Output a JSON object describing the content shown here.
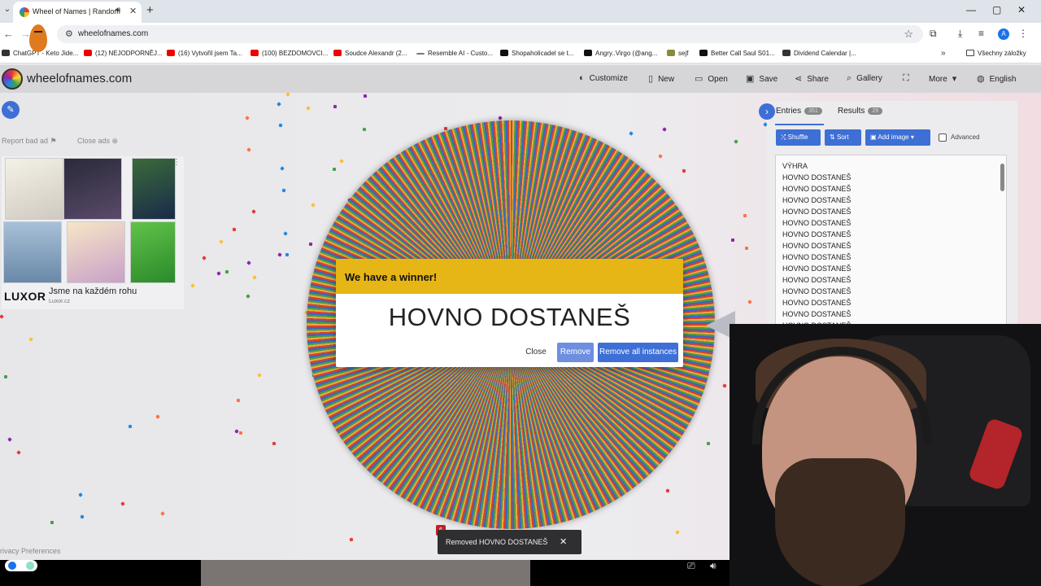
{
  "browser": {
    "tab_title": "Wheel of Names | Random",
    "url": "wheelofnames.com",
    "profile_initial": "A",
    "bookmarks": [
      {
        "label": "ChatGPT - Keto Jide...",
        "icon": "chatgpt-icon"
      },
      {
        "label": "(12) NEJODPORNĚJ...",
        "icon": "youtube-icon"
      },
      {
        "label": "(16) Vytvořil jsem Ta...",
        "icon": "youtube-icon"
      },
      {
        "label": "(100) BEZDOMOVCI...",
        "icon": "youtube-icon"
      },
      {
        "label": "Soudce Alexandr (2...",
        "icon": "youtube-icon"
      },
      {
        "label": "Resemble AI - Custo...",
        "icon": "resemble-icon"
      },
      {
        "label": "Shopaholicadel se t...",
        "icon": "x-icon"
      },
      {
        "label": "Angry..Virgo (@ang...",
        "icon": "tiktok-icon"
      },
      {
        "label": "sejf",
        "icon": "sejf-icon"
      },
      {
        "label": "Better Call Saul S01...",
        "icon": "film-icon"
      },
      {
        "label": "Dividend Calendar |...",
        "icon": "calendar-icon"
      }
    ],
    "bookmarks_folder": "Všechny záložky"
  },
  "site": {
    "logo_text": "wheelofnames.com",
    "menu": [
      {
        "label": "Customize",
        "icon": "palette-icon"
      },
      {
        "label": "New",
        "icon": "file-icon"
      },
      {
        "label": "Open",
        "icon": "folder-open-icon"
      },
      {
        "label": "Save",
        "icon": "save-icon"
      },
      {
        "label": "Share",
        "icon": "share-icon"
      },
      {
        "label": "Gallery",
        "icon": "search-icon"
      },
      {
        "label": "",
        "icon": "fullscreen-icon"
      },
      {
        "label": "More",
        "icon": "chevron-down-icon"
      },
      {
        "label": "English",
        "icon": "globe-icon"
      }
    ]
  },
  "ad": {
    "report_label": "Report bad ad",
    "close_label": "Close ads",
    "brand": "LUXOR",
    "title": "Jsme na každém rohu",
    "url": "Luxor.cz"
  },
  "privacy_label": "rivacy Preferences",
  "panel": {
    "tabs": [
      {
        "label": "Entries",
        "count": "351"
      },
      {
        "label": "Results",
        "count": "29"
      }
    ],
    "buttons": {
      "shuffle": "Shuffle",
      "sort": "Sort",
      "add_image": "Add image"
    },
    "advanced_label": "Advanced",
    "entries": [
      "VÝHRA",
      "HOVNO DOSTANEŠ",
      "HOVNO DOSTANEŠ",
      "HOVNO DOSTANEŠ",
      "HOVNO DOSTANEŠ",
      "HOVNO DOSTANEŠ",
      "HOVNO DOSTANEŠ",
      "HOVNO DOSTANEŠ",
      "HOVNO DOSTANEŠ",
      "HOVNO DOSTANEŠ",
      "HOVNO DOSTANEŠ",
      "HOVNO DOSTANEŠ",
      "HOVNO DOSTANEŠ",
      "HOVNO DOSTANEŠ",
      "HOVNO DOSTANEŠ",
      "HOVNO DOSTANEŠ",
      "HOVNO DOSTANEŠ",
      "HOVNO DOSTANEŠ"
    ]
  },
  "modal": {
    "title": "We have a winner!",
    "winner": "HOVNO DOSTANEŠ",
    "close_label": "Close",
    "remove_label": "Remove",
    "remove_all_label": "Remove all instances"
  },
  "toast": {
    "text": "Removed HOVNO DOSTANEŠ",
    "count": "6"
  },
  "colors": {
    "accent": "#3d6fd6",
    "winner_header": "#e6b516",
    "wheel_segments": [
      "#d64032",
      "#e8a93a",
      "#4a9d45",
      "#3866c5"
    ]
  }
}
